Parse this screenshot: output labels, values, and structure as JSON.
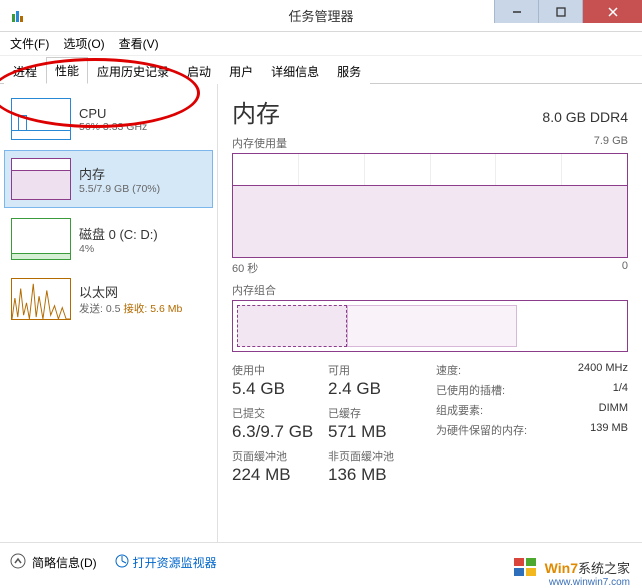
{
  "window": {
    "title": "任务管理器",
    "menus": {
      "file": "文件(F)",
      "options": "选项(O)",
      "view": "查看(V)"
    },
    "tabs": {
      "processes": "进程",
      "performance": "性能",
      "app_history": "应用历史记录",
      "startup": "启动",
      "users": "用户",
      "details": "详细信息",
      "services": "服务"
    }
  },
  "sidebar": {
    "cpu": {
      "title": "CPU",
      "line": "56% 3.33 GHz"
    },
    "memory": {
      "title": "内存",
      "line": "5.5/7.9 GB (70%)"
    },
    "disk": {
      "title": "磁盘 0 (C: D:)",
      "line": "4%"
    },
    "ethernet": {
      "title": "以太网",
      "send_label": "发送:",
      "send_val": "0.5",
      "recv_label": "接收:",
      "recv_val": "5.6 Mb"
    }
  },
  "main": {
    "title": "内存",
    "total": "8.0 GB DDR4",
    "usage_label": "内存使用量",
    "usage_max": "7.9 GB",
    "axis_left": "60 秒",
    "axis_right": "0",
    "composition_label": "内存组合",
    "stats": {
      "in_use_label": "使用中",
      "in_use": "5.4 GB",
      "available_label": "可用",
      "available": "2.4 GB",
      "committed_label": "已提交",
      "committed": "6.3/9.7 GB",
      "cached_label": "已缓存",
      "cached": "571 MB",
      "paged_label": "页面缓冲池",
      "paged": "224 MB",
      "nonpaged_label": "非页面缓冲池",
      "nonpaged": "136 MB"
    },
    "right": {
      "speed_k": "速度:",
      "speed_v": "2400 MHz",
      "slots_k": "已使用的插槽:",
      "slots_v": "1/4",
      "form_k": "组成要素:",
      "form_v": "DIMM",
      "hw_k": "为硬件保留的内存:",
      "hw_v": "139 MB"
    }
  },
  "footer": {
    "fewer": "简略信息(D)",
    "resmon": "打开资源监视器"
  },
  "watermark": {
    "t1": "Win7",
    "t2": "系统之家",
    "url": "www.winwin7.com"
  },
  "chart_data": {
    "type": "area",
    "title": "内存使用量",
    "xlabel": "60 秒 → 0",
    "ylabel": "GB",
    "ylim": [
      0,
      7.9
    ],
    "x": [
      60,
      50,
      40,
      30,
      20,
      10,
      0
    ],
    "series": [
      {
        "name": "内存",
        "values": [
          5.55,
          5.55,
          5.55,
          5.5,
          5.45,
          5.4,
          5.4
        ]
      }
    ]
  }
}
